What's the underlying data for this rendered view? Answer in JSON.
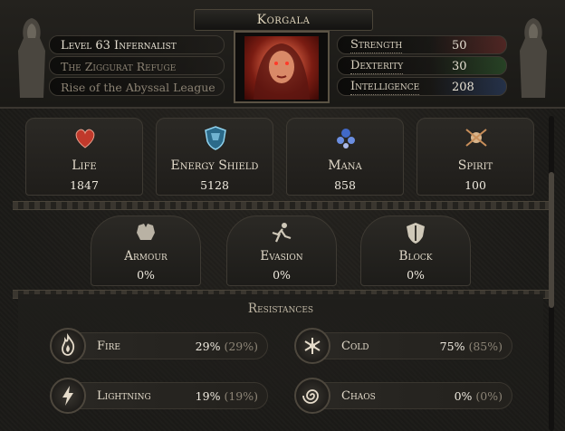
{
  "character": {
    "name": "Korgala",
    "level_class": "Level 63 Infernalist",
    "area": "The Ziggurat Refuge",
    "league": "Rise of the Abyssal League"
  },
  "attributes": [
    {
      "label": "Strength",
      "value": "50",
      "color": "#d23b3b"
    },
    {
      "label": "Dexterity",
      "value": "30",
      "color": "#3fa845"
    },
    {
      "label": "Intelligence",
      "value": "208",
      "color": "#3d6fd1"
    }
  ],
  "core_stats": [
    {
      "label": "Life",
      "value": "1847",
      "icon": "heart-icon",
      "color": "#c0392b"
    },
    {
      "label": "Energy Shield",
      "value": "5128",
      "icon": "shield-icon",
      "color": "#5ea5c9"
    },
    {
      "label": "Mana",
      "value": "858",
      "icon": "mana-icon",
      "color": "#4169c8"
    },
    {
      "label": "Spirit",
      "value": "100",
      "icon": "spirit-icon",
      "color": "#d8b48a"
    }
  ],
  "defences": [
    {
      "label": "Armour",
      "value": "0%",
      "icon": "armour-icon"
    },
    {
      "label": "Evasion",
      "value": "0%",
      "icon": "evasion-icon"
    },
    {
      "label": "Block",
      "value": "0%",
      "icon": "block-icon"
    }
  ],
  "resistances": {
    "title": "Resistances",
    "items": [
      {
        "label": "Fire",
        "value": "29%",
        "max": "(29%)",
        "icon": "fire-icon"
      },
      {
        "label": "Cold",
        "value": "75%",
        "max": "(85%)",
        "icon": "cold-icon"
      },
      {
        "label": "Lightning",
        "value": "19%",
        "max": "(19%)",
        "icon": "lightning-icon"
      },
      {
        "label": "Chaos",
        "value": "0%",
        "max": "(0%)",
        "icon": "chaos-icon"
      }
    ]
  }
}
